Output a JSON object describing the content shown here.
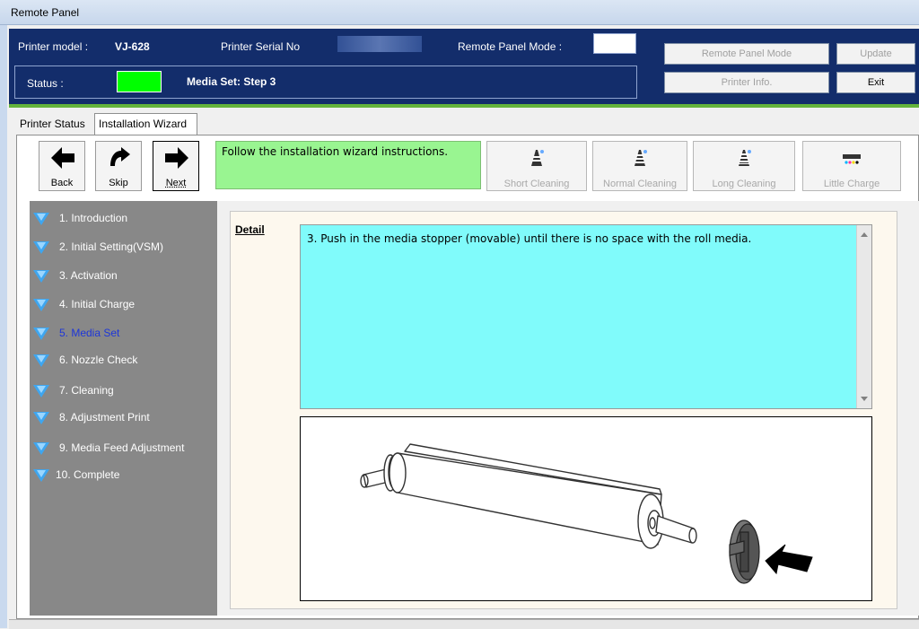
{
  "window": {
    "title": "Remote Panel"
  },
  "header": {
    "printer_model_label": "Printer model :",
    "printer_model_value": "VJ-628",
    "serial_label": "Printer Serial No",
    "remote_mode_label": "Remote Panel Mode :",
    "status_label": "Status :",
    "status_color": "#00ff00",
    "status_text": "Media Set: Step 3",
    "buttons": {
      "remote_panel_mode": "Remote Panel Mode",
      "update": "Update",
      "printer_info": "Printer Info.",
      "exit": "Exit"
    }
  },
  "tabs": [
    {
      "label": "Printer Status",
      "active": false
    },
    {
      "label": "Installation Wizard",
      "active": true
    }
  ],
  "toolbar": {
    "back": "Back",
    "skip": "Skip",
    "next": "Next",
    "instruction": "Follow the installation wizard instructions.",
    "cleaning": {
      "short": "Short Cleaning",
      "normal": "Normal Cleaning",
      "long": "Long Cleaning",
      "little_charge": "Little Charge"
    }
  },
  "steps": [
    {
      "label": "1. Introduction"
    },
    {
      "label": "2. Initial Setting(VSM)"
    },
    {
      "label": "3. Activation"
    },
    {
      "label": "4. Initial Charge"
    },
    {
      "label": "5. Media Set",
      "current": true
    },
    {
      "label": "6. Nozzle Check"
    },
    {
      "label": "7. Cleaning"
    },
    {
      "label": "8. Adjustment Print"
    },
    {
      "label": "9. Media Feed Adjustment"
    },
    {
      "label": "10. Complete"
    }
  ],
  "detail": {
    "label": "Detail",
    "text": "3. Push in the media stopper (movable) until there is no space with the roll media."
  },
  "colors": {
    "header_bg": "#132d6b",
    "instruction_bg": "#99f591",
    "detail_bg": "#80fbfb",
    "sidebar_bg": "#888888",
    "current_step": "#1d36d9"
  }
}
